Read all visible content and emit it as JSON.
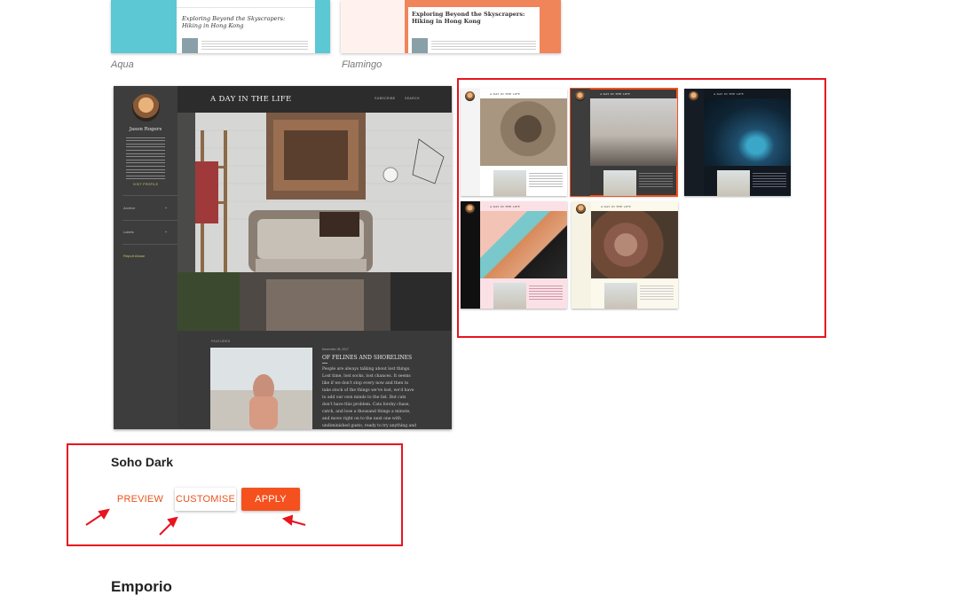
{
  "top_themes": [
    {
      "caption": "Aqua",
      "post_title": "Exploring Beyond the Skyscrapers: Hiking in Hong Kong",
      "accent": "#5bc8d4"
    },
    {
      "caption": "Flamingo",
      "post_title": "Exploring Beyond the Skyscrapers: Hiking in Hong Kong",
      "accent": "#f0855a"
    }
  ],
  "preview": {
    "blog_title": "A DAY IN THE LIFE",
    "nav": [
      "SUBSCRIBE",
      "SEARCH"
    ],
    "author_name": "Jason Rogers",
    "visit_profile": "VISIT PROFILE",
    "sidebar_sections": [
      "Archive",
      "Labels"
    ],
    "report_abuse": "Report Abuse",
    "featured_label": "FEATURED",
    "post_date": "November 08, 2017",
    "post_title": "OF FELINES AND SHORELINES",
    "post_body": "People are always talking about lost things. Lost time, lost socks, lost chances. It seems like if we don't stop every now and then to take stock of the things we've lost, we'd have to add our own minds to the list. But cats don't have this problem. Cats forshy chase, catch, and lose a thousand things a minute, and move right on to the next one with undiminished gusto, ready to try anything and everything once again, ready to give the grand pursuit another shot. Losing everything but the whole point."
  },
  "variants": [
    {
      "id": "light-cat",
      "title": "A DAY IN THE LIFE",
      "selected": false
    },
    {
      "id": "dark-room",
      "title": "A DAY IN THE LIFE",
      "selected": true
    },
    {
      "id": "navy-space",
      "title": "A DAY IN THE LIFE",
      "selected": false
    },
    {
      "id": "pink-makeup",
      "title": "A DAY IN THE LIFE",
      "selected": false
    },
    {
      "id": "cream-food",
      "title": "A DAY IN THE LIFE",
      "selected": false
    }
  ],
  "theme": {
    "name": "Soho Dark",
    "buttons": {
      "preview": "PREVIEW",
      "customise": "CUSTOMISE",
      "apply": "APPLY"
    }
  },
  "next_theme_name": "Emporio",
  "colors": {
    "accent": "#f4511e",
    "annotation_red": "#e8141e"
  }
}
